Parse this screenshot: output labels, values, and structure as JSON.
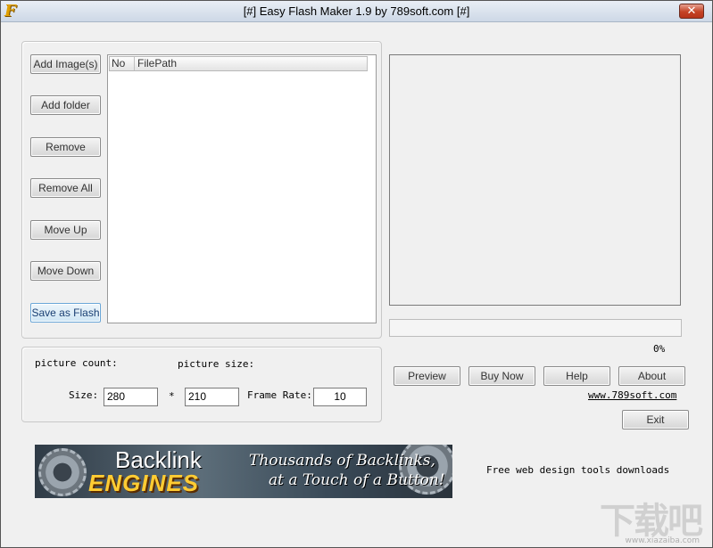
{
  "window": {
    "title": "[#] Easy Flash Maker 1.9 by 789soft.com [#]",
    "icon": "F",
    "close_symbol": "✕"
  },
  "left_buttons": {
    "add_images": "Add Image(s)",
    "add_folder": "Add folder",
    "remove": "Remove",
    "remove_all": "Remove All",
    "move_up": "Move Up",
    "move_down": "Move Down",
    "save_as_flash": "Save as Flash"
  },
  "file_list": {
    "columns": [
      "No",
      "FilePath"
    ],
    "rows": []
  },
  "progress": {
    "percent_label": "0%",
    "value": 0
  },
  "settings": {
    "picture_count_label": "picture count:",
    "picture_size_label": "picture size:",
    "size_label": "Size:",
    "width_value": "280",
    "times_symbol": "*",
    "height_value": "210",
    "frame_rate_label": "Frame Rate:",
    "frame_rate_value": "10"
  },
  "right_buttons": {
    "preview": "Preview",
    "buy_now": "Buy Now",
    "help": "Help",
    "about": "About",
    "exit": "Exit"
  },
  "website_link": "www.789soft.com",
  "banner": {
    "title_line1": "Backlink",
    "title_line2": "ENGINES",
    "tagline_line1": "Thousands of Backlinks,",
    "tagline_line2": "at a Touch of a Button!"
  },
  "promo_text": "Free web design tools downloads",
  "watermark": {
    "text": "下载吧",
    "url": "www.xiazaiba.com"
  },
  "colors": {
    "window_bg": "#f0f0f0",
    "close_button": "#c44225",
    "banner_accent": "#ffcc33"
  }
}
